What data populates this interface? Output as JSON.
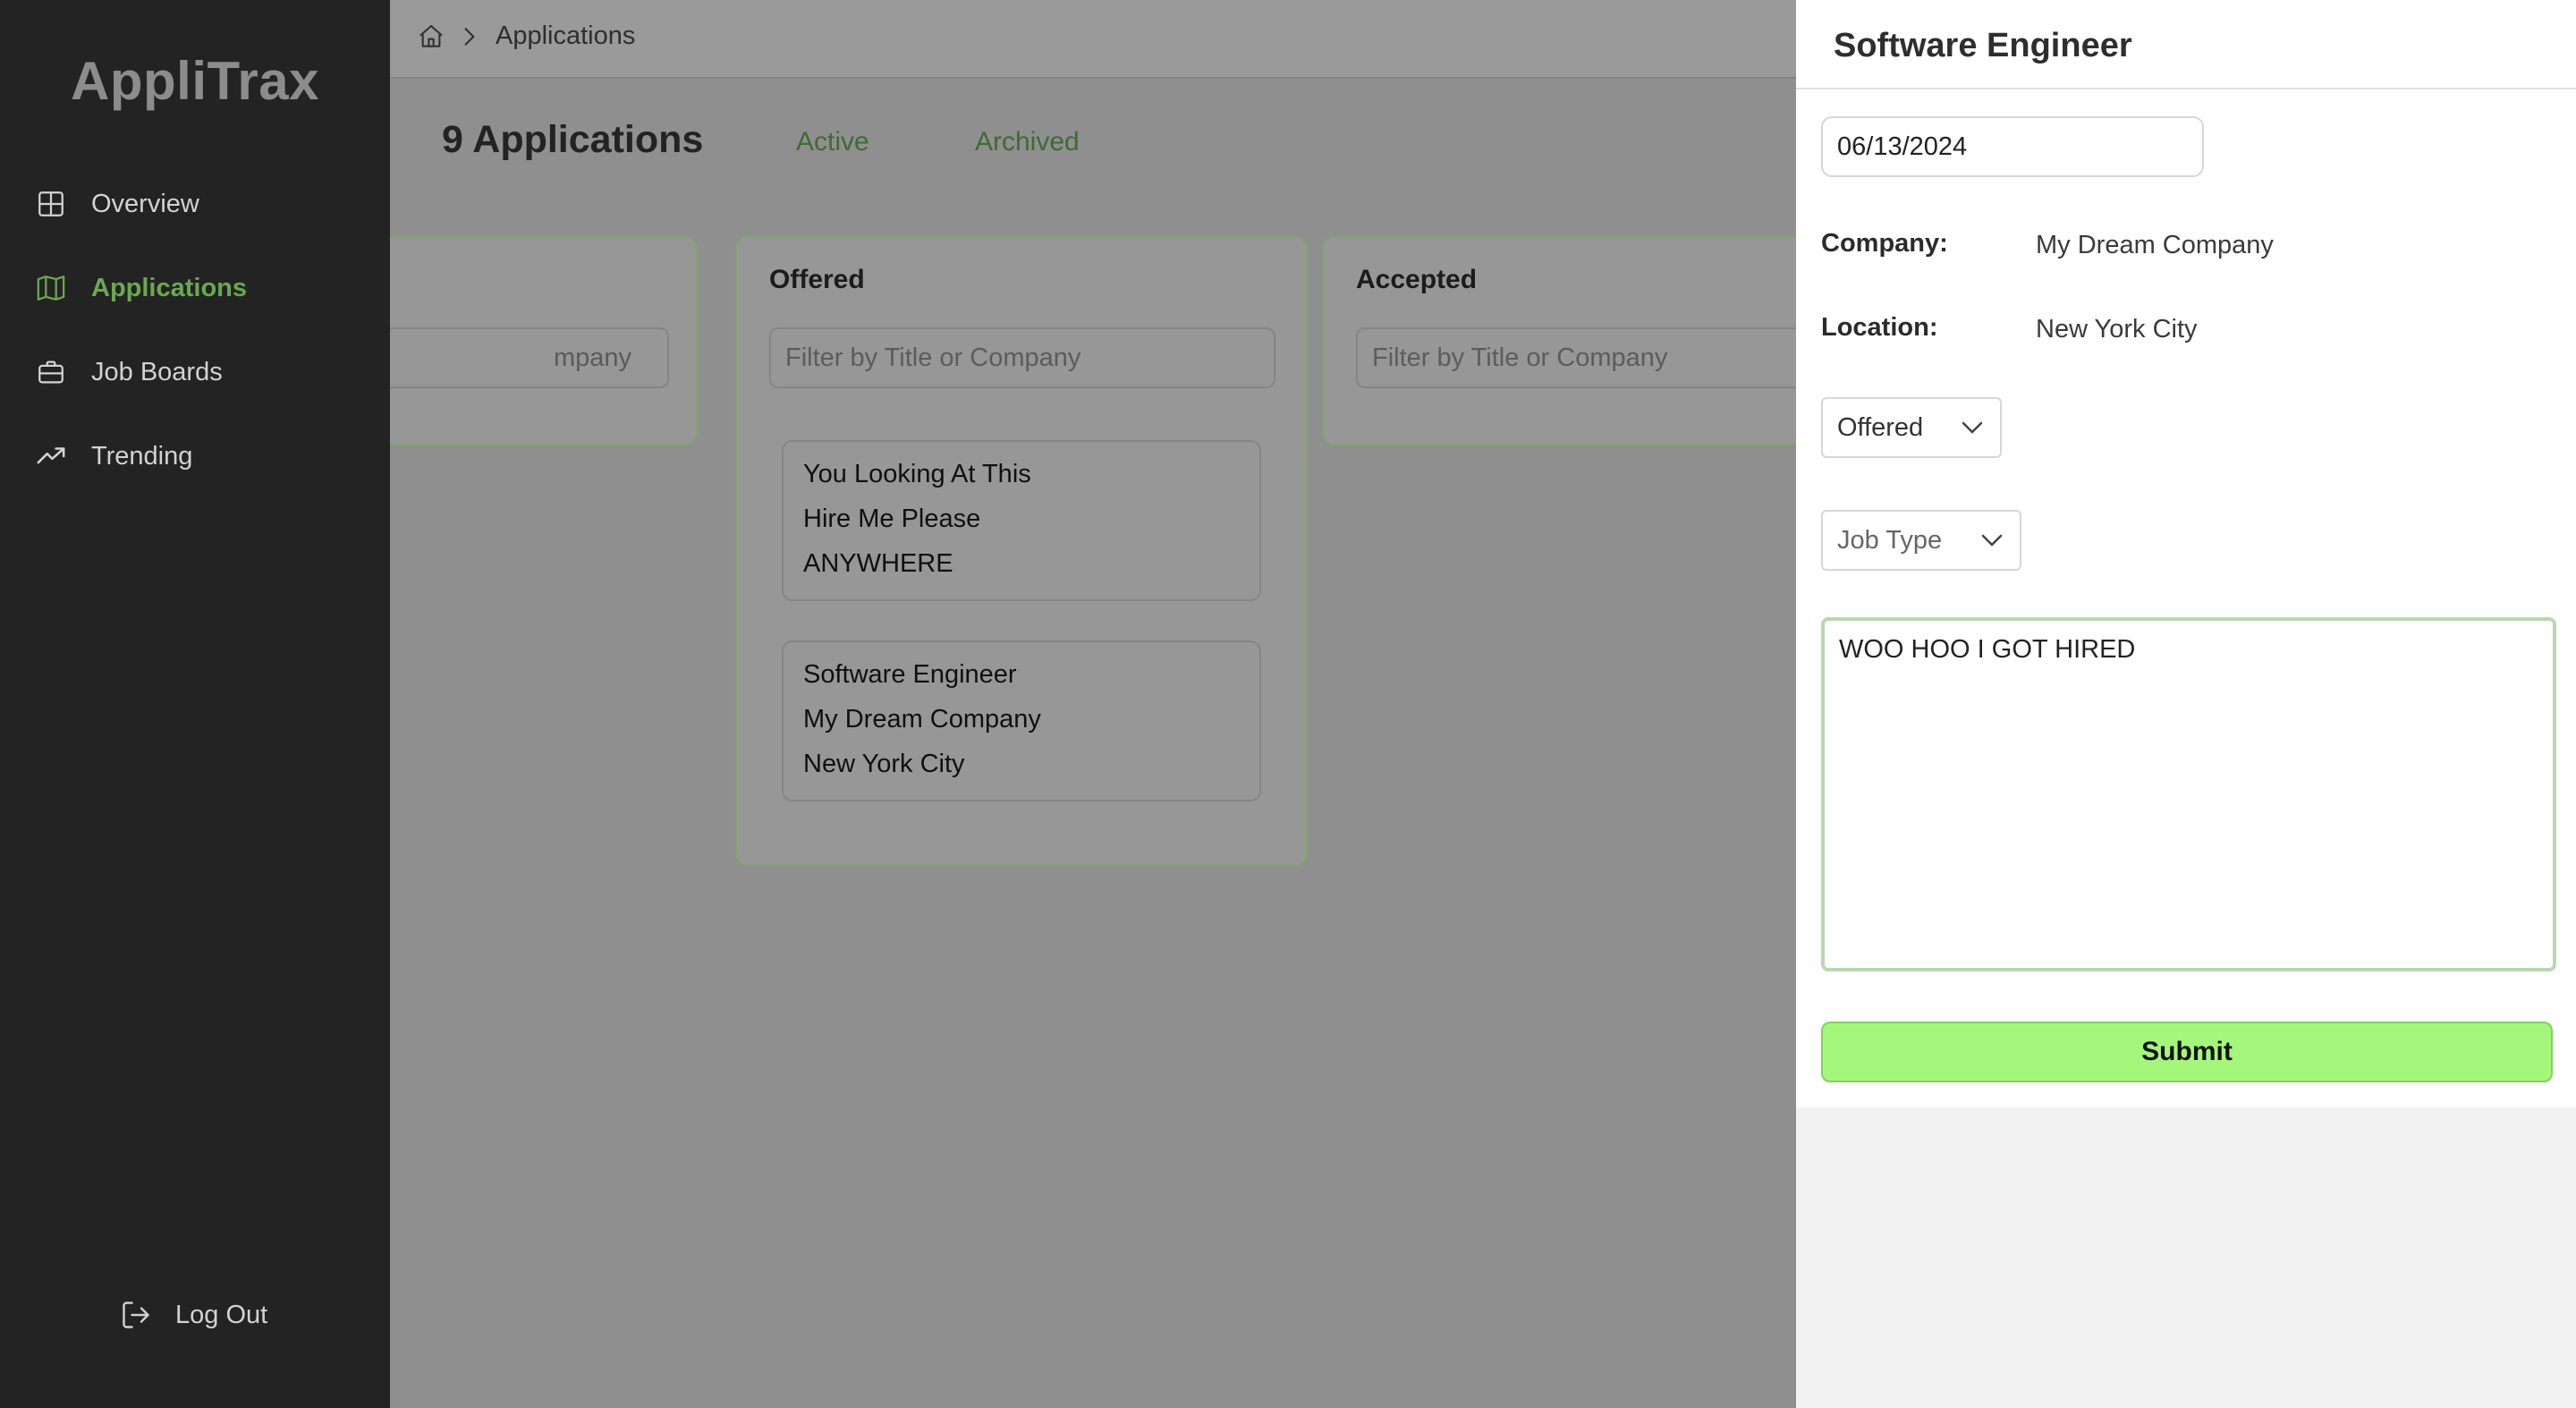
{
  "app": {
    "brand": "AppliTrax"
  },
  "sidebar": {
    "items": [
      {
        "label": "Overview",
        "icon": "grid-icon"
      },
      {
        "label": "Applications",
        "icon": "map-icon",
        "active": true
      },
      {
        "label": "Job Boards",
        "icon": "briefcase-icon"
      },
      {
        "label": "Trending",
        "icon": "trending-icon"
      }
    ],
    "logout_label": "Log Out"
  },
  "breadcrumb": {
    "current": "Applications"
  },
  "main": {
    "title": "9 Applications",
    "tabs": [
      {
        "label": "Active"
      },
      {
        "label": "Archived"
      }
    ],
    "columns": [
      {
        "title": "",
        "filter_placeholder": "Filter by Title or Company",
        "filter_visible_text": "mpany"
      },
      {
        "title": "Offered",
        "filter_placeholder": "Filter by Title or Company",
        "cards": [
          {
            "title": "You Looking At This",
            "company": "Hire Me Please",
            "location": "ANYWHERE"
          },
          {
            "title": "Software Engineer",
            "company": "My Dream Company",
            "location": "New York City"
          }
        ]
      },
      {
        "title": "Accepted",
        "filter_placeholder": "Filter by Title or Company"
      }
    ]
  },
  "detail": {
    "title": "Software Engineer",
    "date": "06/13/2024",
    "company_label": "Company:",
    "company": "My Dream Company",
    "location_label": "Location:",
    "location": "New York City",
    "status": "Offered",
    "job_type": "Job Type",
    "notes": "WOO HOO I GOT HIRED",
    "submit_label": "Submit"
  },
  "colors": {
    "accent": "#6aa84f",
    "submit": "#a4f77a",
    "sidebar_bg": "#232323",
    "overlay": "#8f8f8f"
  }
}
